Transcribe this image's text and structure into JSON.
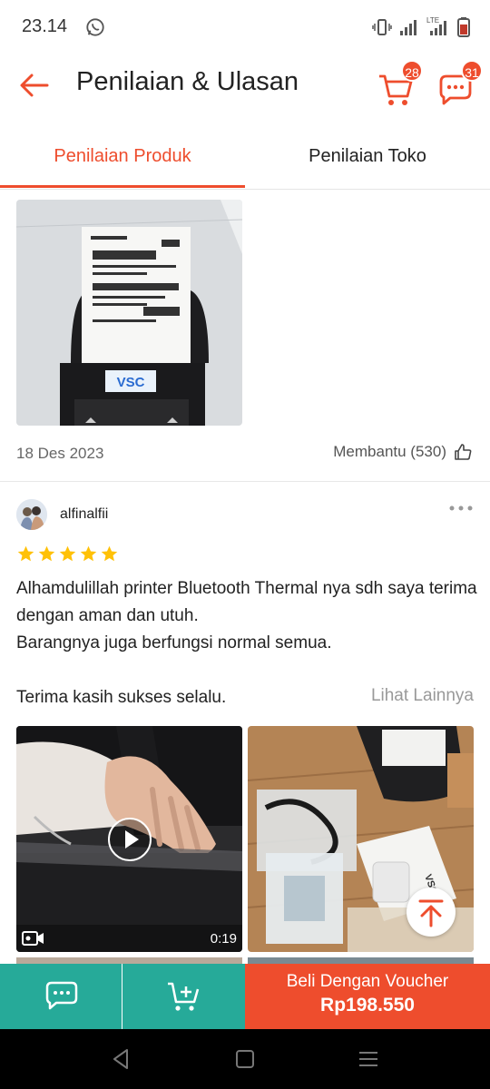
{
  "status_bar": {
    "time": "23.14",
    "network": "LTE"
  },
  "header": {
    "title": "Penilaian & Ulasan",
    "cart_count": "28",
    "chat_count": "31"
  },
  "tabs": [
    {
      "label": "Penilaian Produk",
      "active": true
    },
    {
      "label": "Penilaian Toko",
      "active": false
    }
  ],
  "prev_review": {
    "date": "18 Des 2023",
    "helpful_label": "Membantu (530)",
    "image_label": "VSC"
  },
  "review": {
    "username": "alfinalfii",
    "rating": 5,
    "text_lines": [
      "Alhamdulillah printer Bluetooth Thermal nya sdh saya terima dengan aman dan utuh.",
      "Barangnya juga berfungsi normal semua.",
      "",
      "Terima kasih sukses selalu."
    ],
    "see_more": "Lihat Lainnya",
    "video_duration": "0:19"
  },
  "bottom_bar": {
    "buy_label": "Beli Dengan Voucher",
    "price": "Rp198.550"
  },
  "colors": {
    "accent": "#ee4d2d",
    "teal": "#26aa99",
    "star": "#ffc107"
  }
}
